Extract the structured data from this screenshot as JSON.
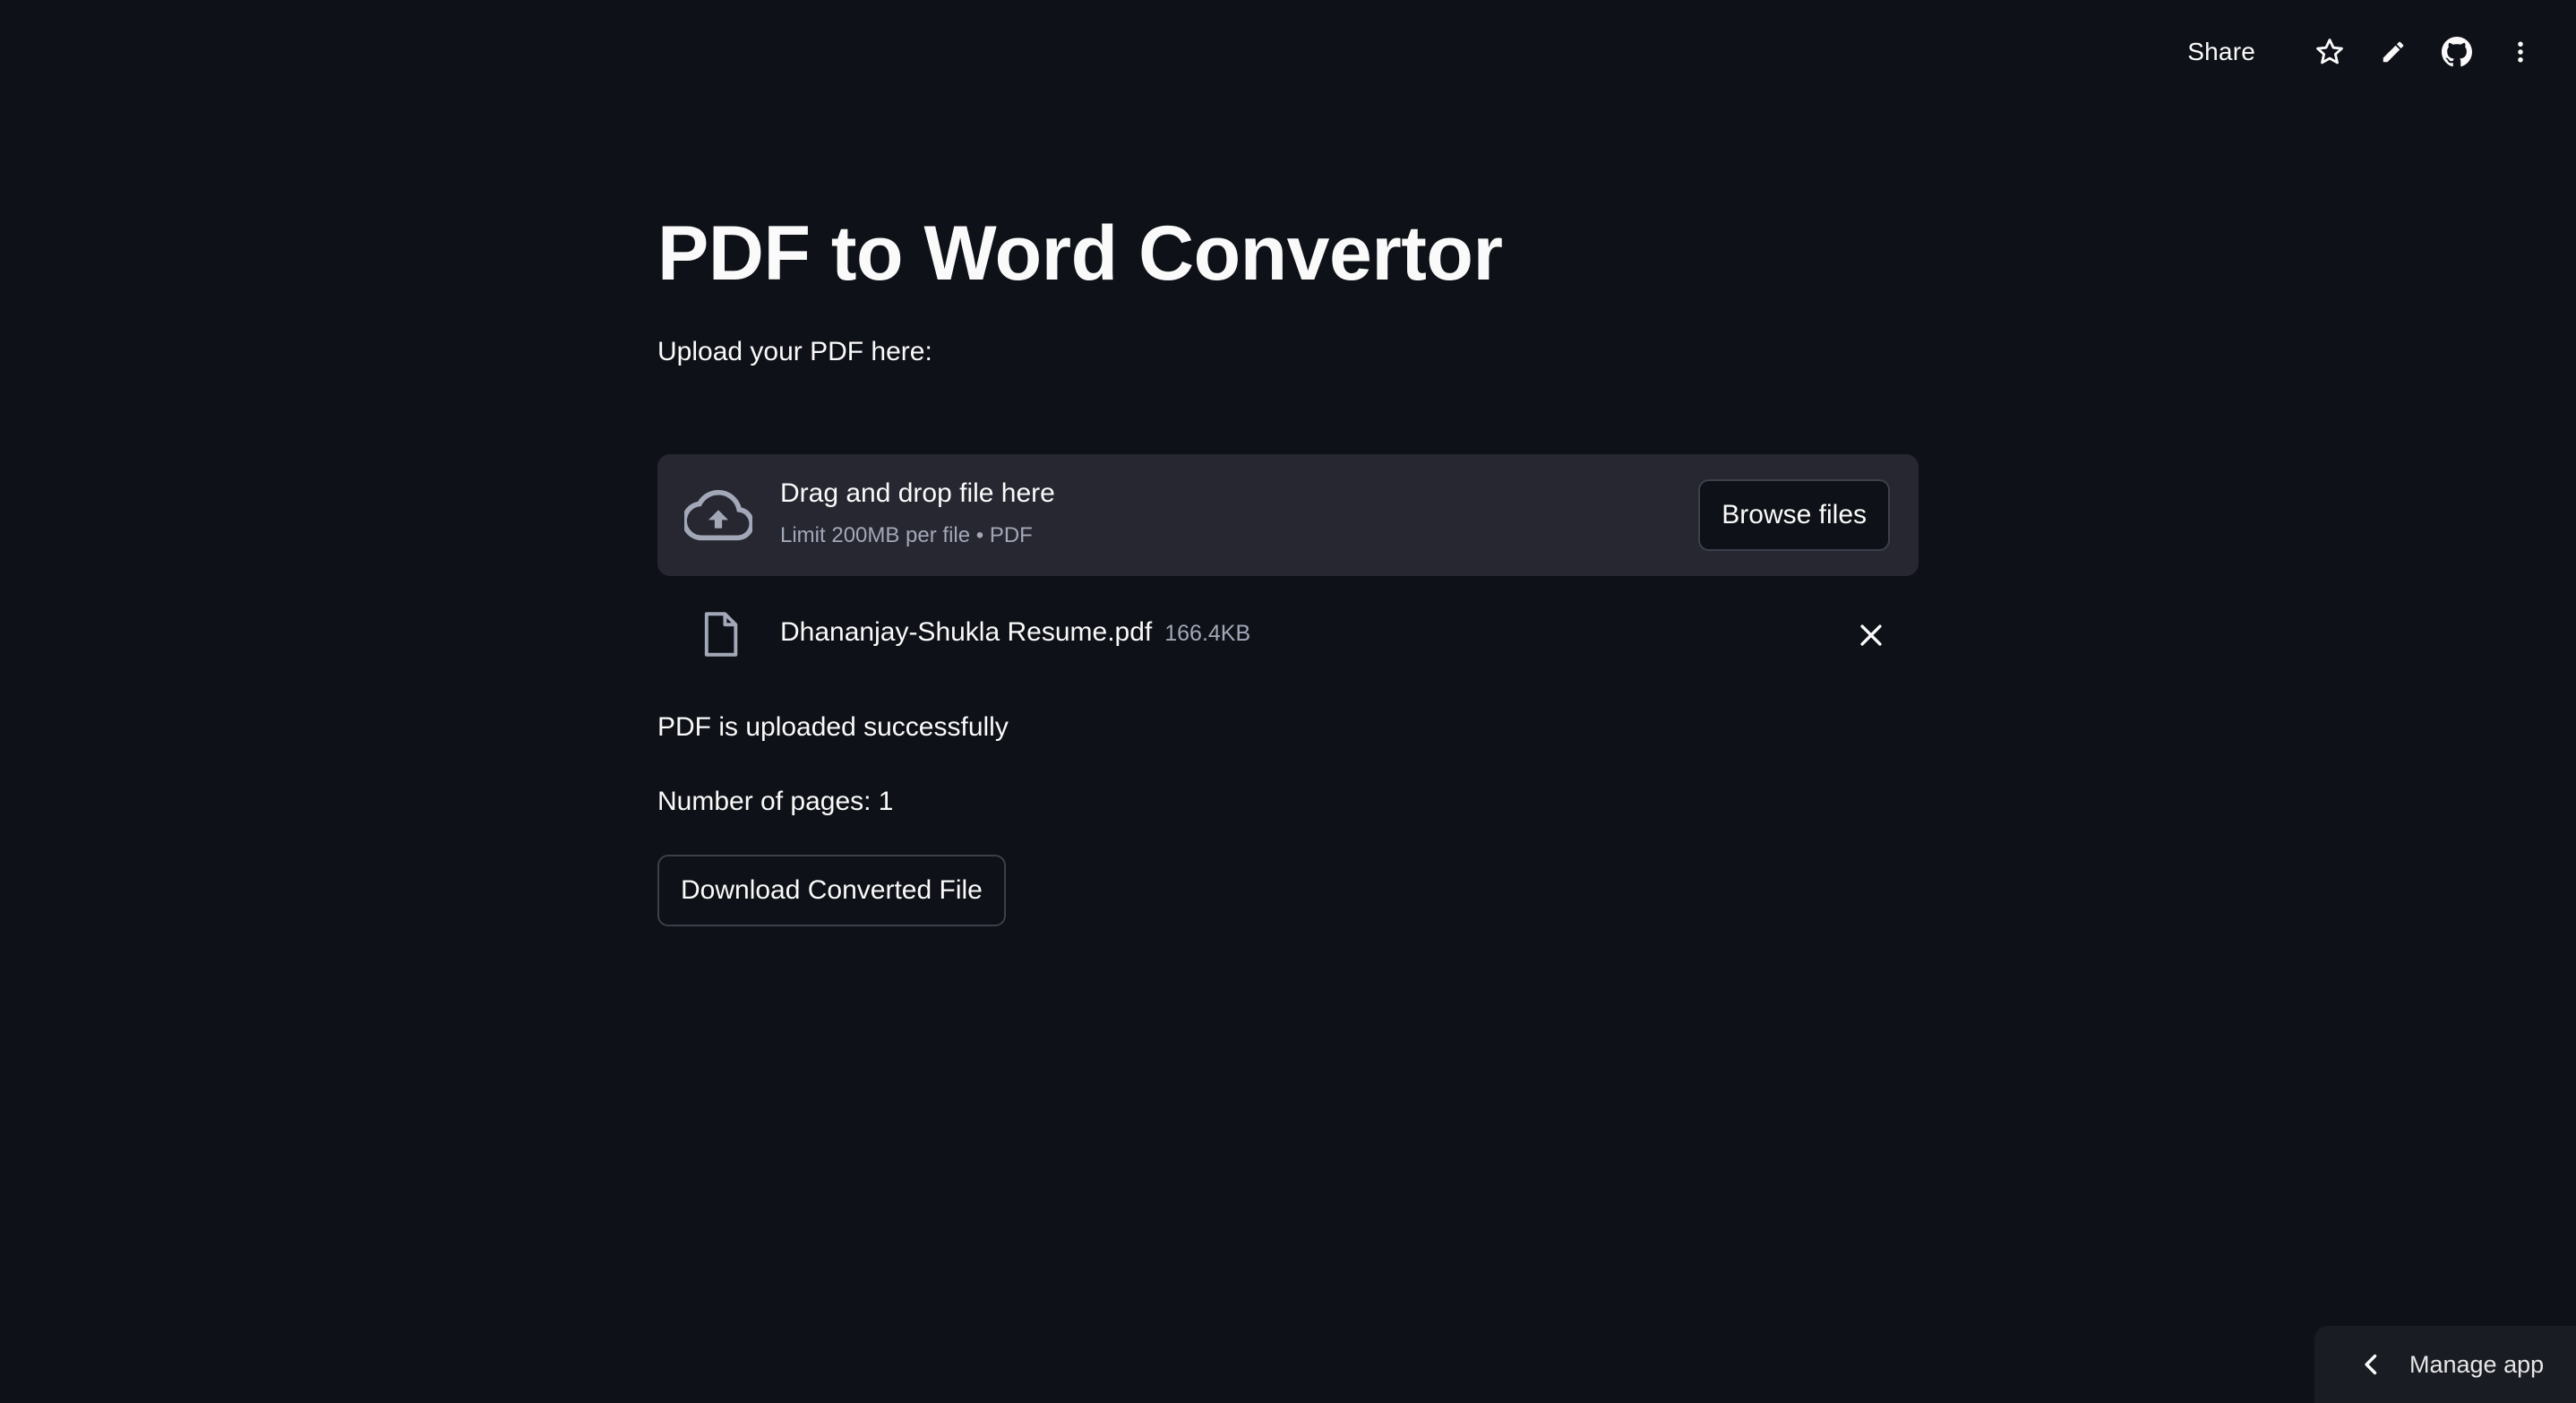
{
  "toolbar": {
    "share_label": "Share",
    "icons": [
      "star-icon",
      "pencil-icon",
      "github-icon",
      "more-vertical-icon"
    ]
  },
  "page": {
    "title": "PDF to Word Convertor",
    "subtitle": "Upload your PDF here:"
  },
  "uploader": {
    "drop_title": "Drag and drop file here",
    "limit_text": "Limit 200MB per file • PDF",
    "browse_label": "Browse files",
    "icon": "cloud-upload-icon"
  },
  "uploaded_file": {
    "name": "Dhananjay-Shukla Resume.pdf",
    "size": "166.4KB",
    "icon": "file-icon"
  },
  "status": {
    "message": "PDF is uploaded successfully",
    "pages_text": "Number of pages: 1"
  },
  "actions": {
    "download_label": "Download Converted File"
  },
  "footer": {
    "manage_label": "Manage app"
  },
  "colors": {
    "background": "#0e1117",
    "surface": "#262730",
    "text": "#fafafa",
    "muted": "#a3a8b8",
    "border": "#3d3f4a"
  }
}
